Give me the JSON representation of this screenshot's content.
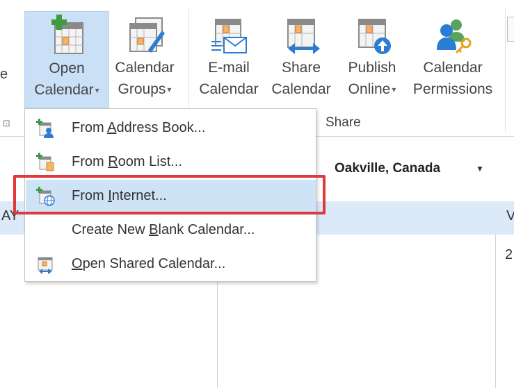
{
  "ribbon": {
    "left_sliver_text": "e",
    "buttons": [
      {
        "line1": "Open",
        "line2": "Calendar",
        "icon": "open-calendar-icon",
        "dropdown": true
      },
      {
        "line1": "Calendar",
        "line2": "Groups",
        "icon": "calendar-groups-icon",
        "dropdown": true
      },
      {
        "line1": "E-mail",
        "line2": "Calendar",
        "icon": "email-calendar-icon",
        "dropdown": false
      },
      {
        "line1": "Share",
        "line2": "Calendar",
        "icon": "share-calendar-icon",
        "dropdown": false
      },
      {
        "line1": "Publish",
        "line2": "Online",
        "icon": "publish-online-icon",
        "dropdown": true
      },
      {
        "line1": "Calendar",
        "line2": "Permissions",
        "icon": "calendar-permissions-icon",
        "dropdown": false
      }
    ],
    "groups": {
      "share": "Share"
    },
    "dialog_launcher": "⊡"
  },
  "location": {
    "city": "Oakville, Canada",
    "caret": "▼"
  },
  "calendar": {
    "left_header_fragment": "AY",
    "right_header_fragment": "V",
    "right_date_fragment": "2"
  },
  "menu": {
    "items": [
      {
        "pre": "From ",
        "key": "A",
        "post": "ddress Book...",
        "icon": "address-book-icon"
      },
      {
        "pre": "From ",
        "key": "R",
        "post": "oom List...",
        "icon": "room-list-icon"
      },
      {
        "pre": "From ",
        "key": "I",
        "post": "nternet...",
        "icon": "internet-calendar-icon"
      },
      {
        "pre": "Create New ",
        "key": "B",
        "post": "lank Calendar...",
        "icon": ""
      },
      {
        "pre": "",
        "key": "O",
        "post": "pen Shared Calendar...",
        "icon": "shared-calendar-icon"
      }
    ]
  },
  "colors": {
    "accent": "#2b7cd3",
    "active_button": "#c9e0f7",
    "highlight_border": "#e0383b",
    "green_plus": "#3f9b3f"
  }
}
